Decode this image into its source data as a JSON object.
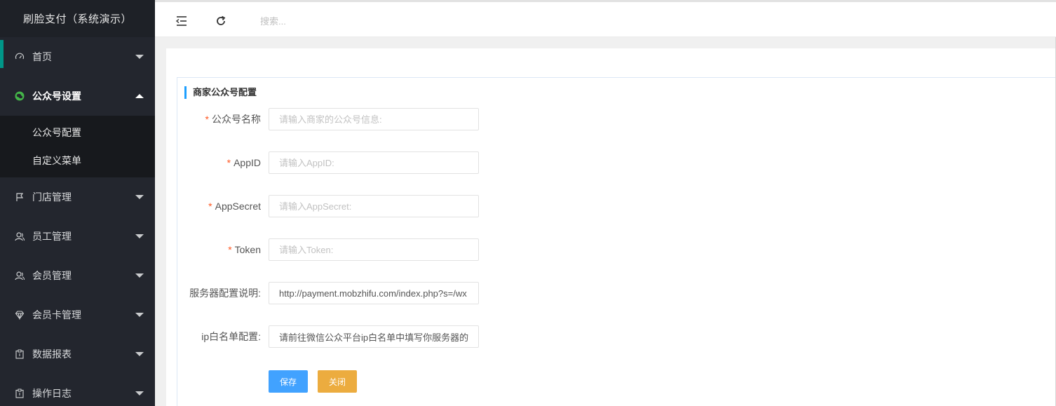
{
  "app": {
    "title": "刷脸支付（系统演示）"
  },
  "colors": {
    "sidebar_bg": "#23262e",
    "accent": "#009688",
    "primary_button": "#41a2ff",
    "warm_button": "#ecac3f",
    "wechat_green": "#44b549"
  },
  "sidebar": {
    "items": [
      {
        "label": "首页",
        "icon": "gauge-icon"
      },
      {
        "label": "公众号设置",
        "icon": "wechat-icon",
        "expanded": true,
        "children": [
          {
            "label": "公众号配置"
          },
          {
            "label": "自定义菜单"
          }
        ]
      },
      {
        "label": "门店管理",
        "icon": "flag-icon"
      },
      {
        "label": "员工管理",
        "icon": "user-icon"
      },
      {
        "label": "会员管理",
        "icon": "user-icon"
      },
      {
        "label": "会员卡管理",
        "icon": "diamond-icon"
      },
      {
        "label": "数据报表",
        "icon": "clipboard-icon"
      },
      {
        "label": "操作日志",
        "icon": "clipboard-icon"
      }
    ]
  },
  "header": {
    "search_placeholder": "搜索..."
  },
  "form": {
    "title": "商家公众号配置",
    "fields": [
      {
        "label": "公众号名称",
        "required": true,
        "placeholder": "请输入商家的公众号信息:",
        "value": ""
      },
      {
        "label": "AppID",
        "required": true,
        "placeholder": "请输入AppID:",
        "value": ""
      },
      {
        "label": "AppSecret",
        "required": true,
        "placeholder": "请输入AppSecret:",
        "value": ""
      },
      {
        "label": "Token",
        "required": true,
        "placeholder": "请输入Token:",
        "value": ""
      },
      {
        "label": "服务器配置说明:",
        "required": false,
        "placeholder": "",
        "value": "http://payment.mobzhifu.com/index.php?s=/wx"
      },
      {
        "label": "ip白名单配置:",
        "required": false,
        "placeholder": "",
        "value": "请前往微信公众平台ip白名单中填写你服务器的"
      }
    ],
    "save_label": "保存",
    "close_label": "关闭"
  }
}
